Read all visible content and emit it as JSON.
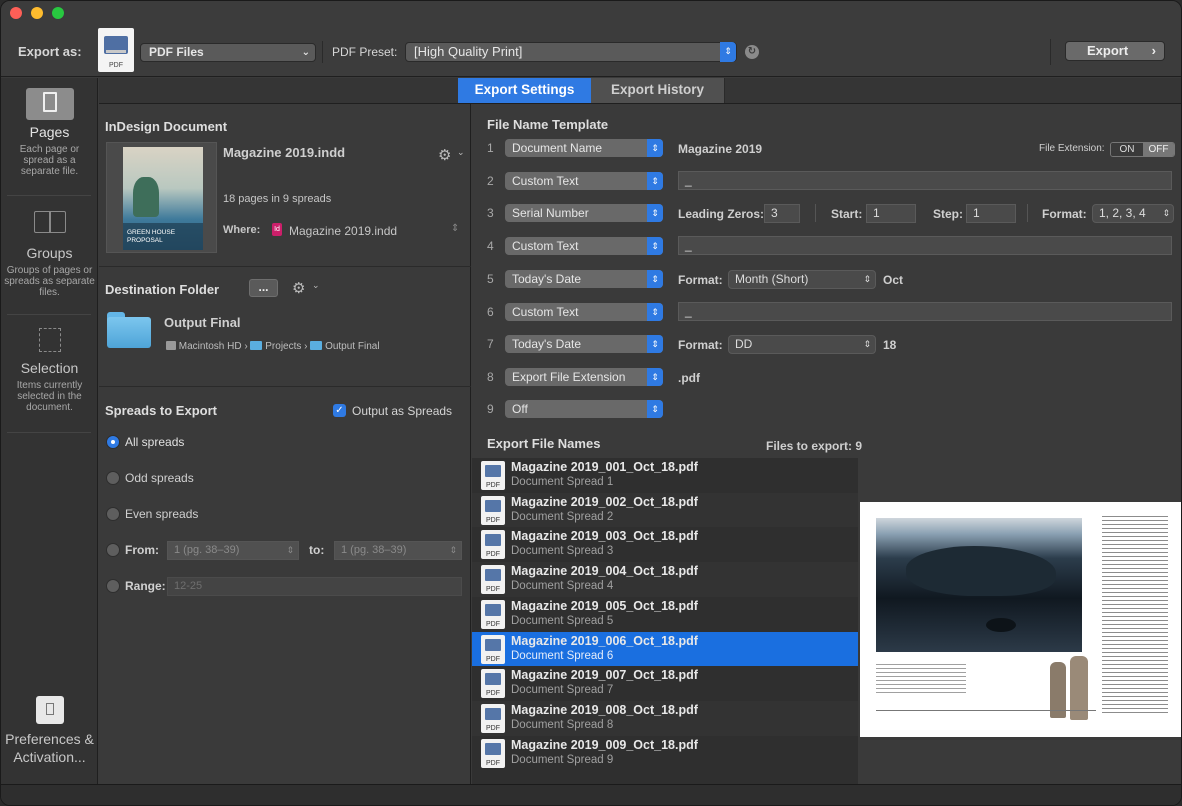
{
  "toolbar": {
    "export_as_label": "Export as:",
    "format_value": "PDF Files",
    "pdf_icon_label": "PDF",
    "preset_label": "PDF Preset:",
    "preset_value": "[High Quality Print]",
    "export_button": "Export"
  },
  "tabs": [
    {
      "label": "Export Settings",
      "active": true
    },
    {
      "label": "Export History",
      "active": false
    }
  ],
  "sidebar": {
    "items": [
      {
        "title": "Pages",
        "desc": "Each page or spread as a separate file.",
        "active": true,
        "icon": "page-icon"
      },
      {
        "title": "Groups",
        "desc": "Groups of pages or spreads as separate files.",
        "active": false,
        "icon": "book-icon"
      },
      {
        "title": "Selection",
        "desc": "Items currently selected in the document.",
        "active": false,
        "icon": "selection-icon"
      }
    ],
    "prefs": "Preferences & Activation..."
  },
  "document": {
    "section_title": "InDesign Document",
    "filename": "Magazine 2019.indd",
    "pages_info": "18 pages in 9 spreads",
    "where_label": "Where:",
    "where_value": "Magazine 2019.indd",
    "thumb_text": "GREEN HOUSE PROPOSAL"
  },
  "destination": {
    "section_title": "Destination Folder",
    "browse_label": "...",
    "folder_name": "Output Final",
    "path": [
      "Macintosh HD",
      "Projects",
      "Output Final"
    ]
  },
  "spreads": {
    "section_title": "Spreads to Export",
    "output_as_spreads": "Output as Spreads",
    "all": "All spreads",
    "odd": "Odd spreads",
    "even": "Even spreads",
    "from_label": "From:",
    "from_value": "1 (pg. 38–39)",
    "to_label": "to:",
    "to_value": "1 (pg. 38–39)",
    "range_label": "Range:",
    "range_placeholder": "12-25"
  },
  "template": {
    "section_title": "File Name Template",
    "file_ext_label": "File Extension:",
    "on": "ON",
    "off": "OFF",
    "rows": [
      {
        "num": "1",
        "token": "Document Name",
        "value": "Magazine 2019"
      },
      {
        "num": "2",
        "token": "Custom Text",
        "value": "_"
      },
      {
        "num": "3",
        "token": "Serial Number",
        "leading_label": "Leading Zeros:",
        "leading": "3",
        "start_label": "Start:",
        "start": "1",
        "step_label": "Step:",
        "step": "1",
        "format_label": "Format:",
        "format": "1, 2, 3, 4"
      },
      {
        "num": "4",
        "token": "Custom Text",
        "value": "_"
      },
      {
        "num": "5",
        "token": "Today's Date",
        "format_label": "Format:",
        "format": "Month (Short)",
        "result": "Oct"
      },
      {
        "num": "6",
        "token": "Custom Text",
        "value": "_"
      },
      {
        "num": "7",
        "token": "Today's Date",
        "format_label": "Format:",
        "format": "DD",
        "result": "18"
      },
      {
        "num": "8",
        "token": "Export File Extension",
        "value": ".pdf"
      },
      {
        "num": "9",
        "token": "Off"
      }
    ]
  },
  "export_names": {
    "section_title": "Export File Names",
    "count": "Files to export: 9",
    "files": [
      {
        "name": "Magazine 2019_001_Oct_18.pdf",
        "sub": "Document Spread 1"
      },
      {
        "name": "Magazine 2019_002_Oct_18.pdf",
        "sub": "Document Spread 2"
      },
      {
        "name": "Magazine 2019_003_Oct_18.pdf",
        "sub": "Document Spread 3"
      },
      {
        "name": "Magazine 2019_004_Oct_18.pdf",
        "sub": "Document Spread 4"
      },
      {
        "name": "Magazine 2019_005_Oct_18.pdf",
        "sub": "Document Spread 5"
      },
      {
        "name": "Magazine 2019_006_Oct_18.pdf",
        "sub": "Document Spread 6",
        "selected": true
      },
      {
        "name": "Magazine 2019_007_Oct_18.pdf",
        "sub": "Document Spread 7"
      },
      {
        "name": "Magazine 2019_008_Oct_18.pdf",
        "sub": "Document Spread 8"
      },
      {
        "name": "Magazine 2019_009_Oct_18.pdf",
        "sub": "Document Spread 9"
      }
    ]
  },
  "colors": {
    "accent": "#2f7ae3",
    "selection": "#1a6fe0",
    "background": "#3a3a3a"
  }
}
